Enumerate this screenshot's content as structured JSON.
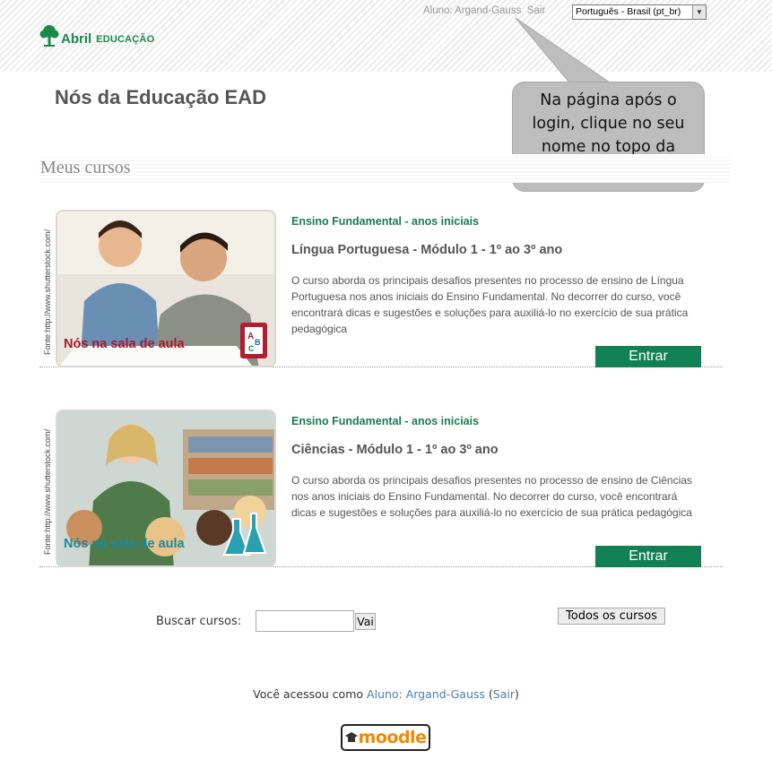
{
  "header": {
    "brand_primary": "Abril",
    "brand_secondary": "EDUCAÇÃO",
    "brand_color": "#1a8a4c",
    "user_link": "Aluno: Argand-Gauss",
    "logout_link": "Sair",
    "language_selected": "Português - Brasil (pt_br)"
  },
  "site_title": "Nós da Educação EAD",
  "callout": {
    "text": "Na página após o login, clique no seu nome no topo da página."
  },
  "section_heading": "Meus cursos",
  "courses": [
    {
      "image_credit": "Fonte:http://www.shutterstock.com/",
      "image_label": "Nós na sala de aula",
      "category": "Ensino Fundamental - anos iniciais",
      "title": "Língua Portuguesa - Módulo 1 - 1º ao 3º ano",
      "description": "O curso aborda os principais desafios presentes no processo de ensino de Língua Portuguesa nos anos iniciais do Ensino Fundamental. No decorrer do curso, você encontrará dicas e sugestões e soluções para auxiliá-lo no exercício de sua prática pedagógica",
      "enter_label": "Entrar"
    },
    {
      "image_credit": "Fonte:http://www.shutterstock.com/",
      "image_label": "Nós na sala de aula",
      "category": "Ensino Fundamental - anos iniciais",
      "title": "Ciências - Módulo 1 - 1º ao 3º ano",
      "description": "O curso aborda os principais desafios presentes no processo de ensino de Ciências nos anos iniciais do Ensino Fundamental. No decorrer do curso, você encontrará dicas e sugestões e soluções para auxiliá-lo no exercício de sua prática pedagógica",
      "enter_label": "Entrar"
    }
  ],
  "search": {
    "label": "Buscar cursos:",
    "value": "",
    "button_label": "Vai",
    "all_courses_label": "Todos os cursos"
  },
  "footer": {
    "logged_in_prefix": "Você acessou como",
    "user_link": "Aluno: Argand-Gauss",
    "logout_link": "Sair",
    "moodle_logo_text": "moodle"
  },
  "colors": {
    "accent_green": "#128055",
    "category_green": "#1a7a55",
    "label_red": "#a31a2e",
    "label_teal": "#1a8aa0",
    "link_blue": "#4a7bbd"
  },
  "icons": [
    "tree-logo-icon",
    "select-arrow-icon",
    "abc-book-icon",
    "flask-icon",
    "graduation-cap-icon"
  ]
}
